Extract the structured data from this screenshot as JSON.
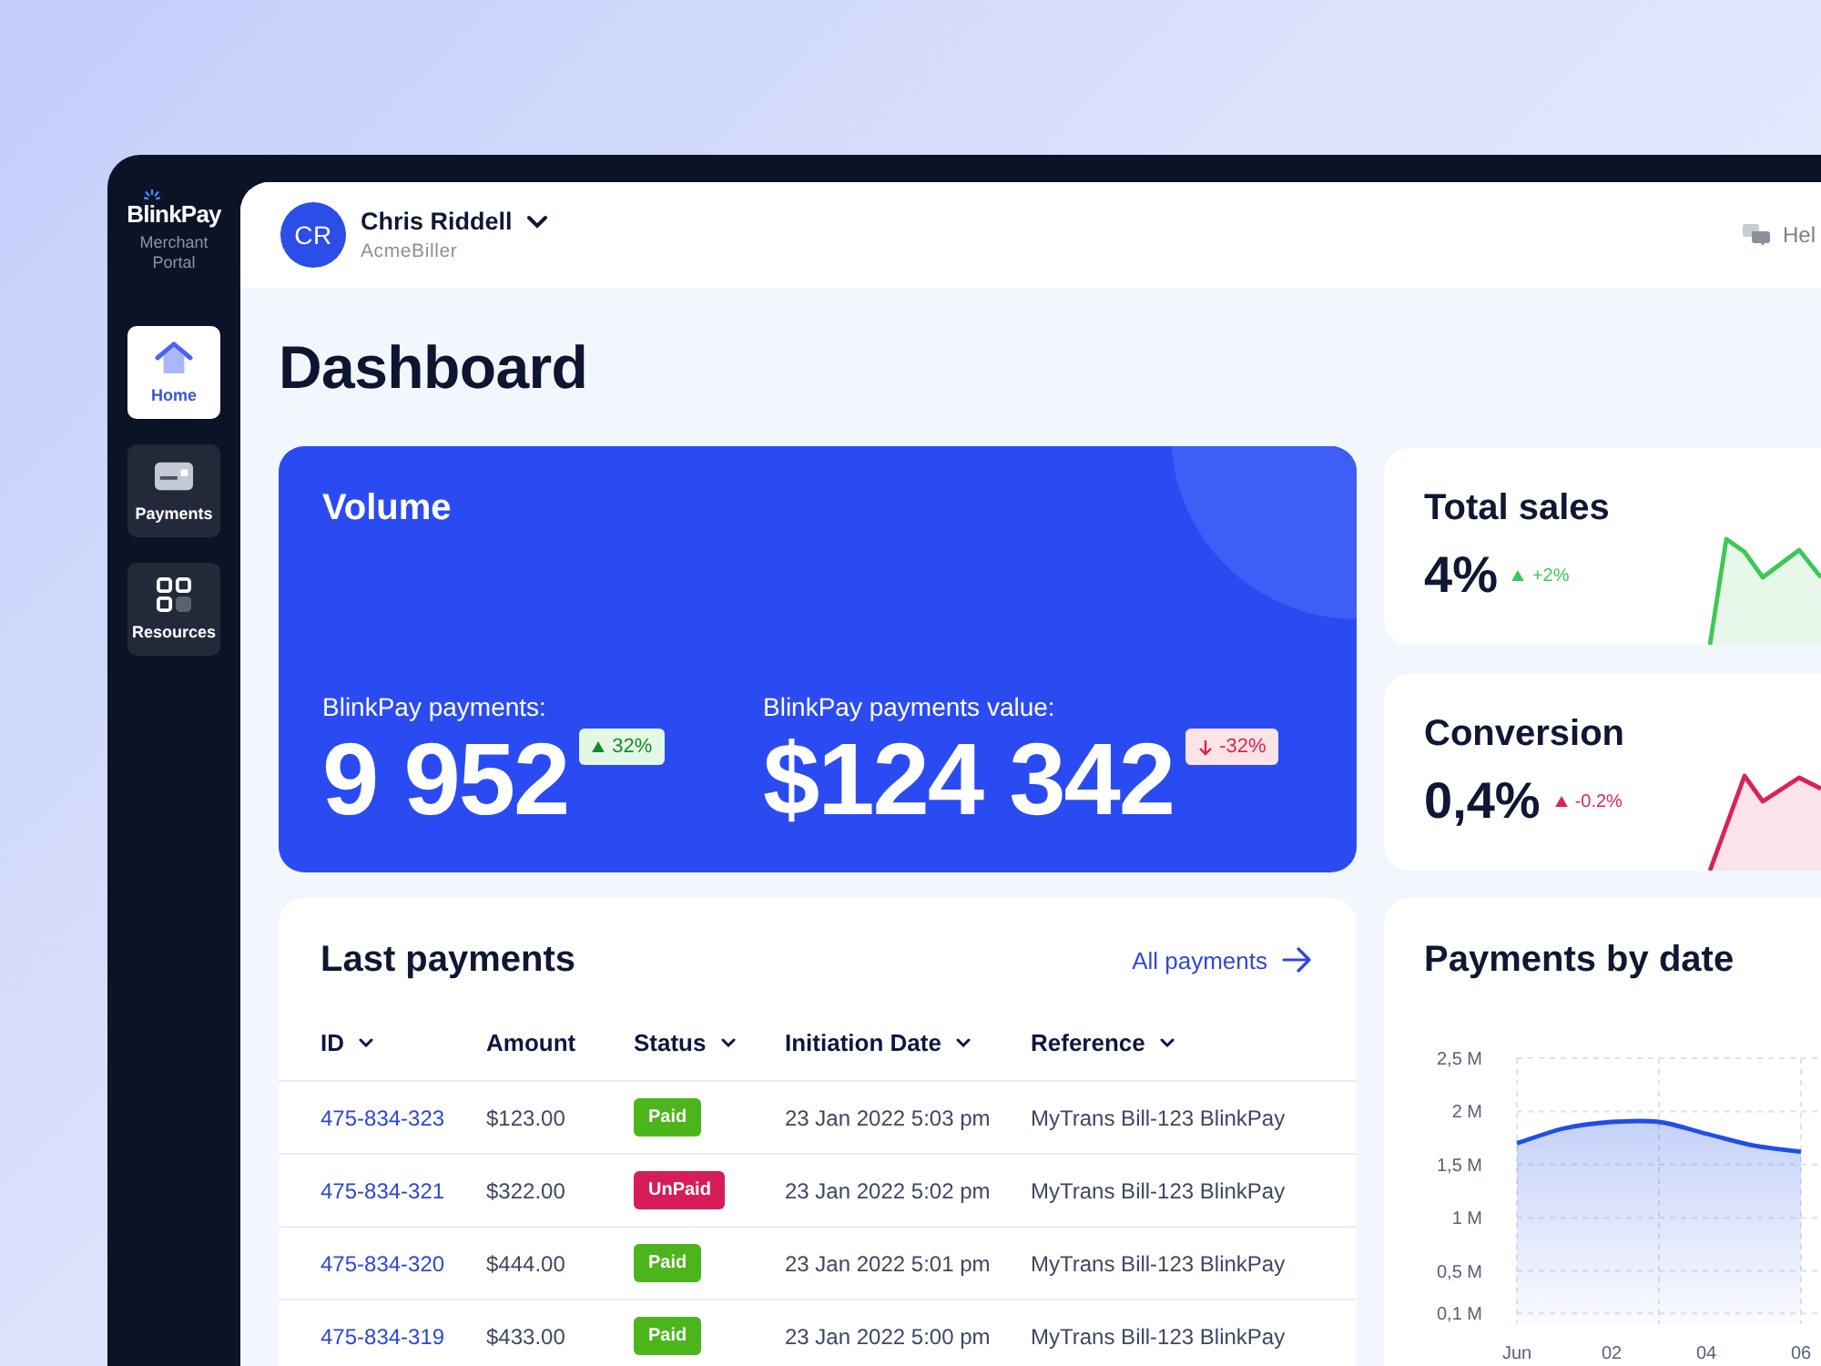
{
  "sidebar": {
    "logo": "BlinkPay",
    "subtitle": "Merchant Portal",
    "items": [
      {
        "label": "Home",
        "selected": true
      },
      {
        "label": "Payments",
        "selected": false
      },
      {
        "label": "Resources",
        "selected": false
      }
    ]
  },
  "header": {
    "user": {
      "initials": "CR",
      "name": "Chris Riddell",
      "company": "AcmeBiller"
    },
    "help": "Hel"
  },
  "page_title": "Dashboard",
  "volume": {
    "title": "Volume",
    "stats": [
      {
        "label": "BlinkPay payments:",
        "value": "9 952",
        "change": "32%",
        "kind": "up"
      },
      {
        "label": "BlinkPay payments value:",
        "value": "$124 342",
        "change": "-32%",
        "kind": "down"
      }
    ]
  },
  "metrics": [
    {
      "title": "Total sales",
      "value": "4%",
      "change": "+2%",
      "color": "#3cc853"
    },
    {
      "title": "Conversion",
      "value": "0,4%",
      "change": "-0.2%",
      "color": "#d92356"
    }
  ],
  "last_payments": {
    "title": "Last payments",
    "link": "All payments",
    "columns": [
      {
        "label": "ID",
        "sortable": true
      },
      {
        "label": "Amount",
        "sortable": false
      },
      {
        "label": "Status",
        "sortable": true
      },
      {
        "label": "Initiation Date",
        "sortable": true
      },
      {
        "label": "Reference",
        "sortable": true
      }
    ],
    "rows": [
      {
        "id": "475-834-323",
        "amount": "$123.00",
        "status": {
          "label": "Paid",
          "kind": "paid"
        },
        "date": "23 Jan 2022 5:03 pm",
        "reference": "MyTrans Bill-123 BlinkPay"
      },
      {
        "id": "475-834-321",
        "amount": "$322.00",
        "status": {
          "label": "UnPaid",
          "kind": "unpaid"
        },
        "date": "23 Jan 2022 5:02 pm",
        "reference": "MyTrans Bill-123 BlinkPay"
      },
      {
        "id": "475-834-320",
        "amount": "$444.00",
        "status": {
          "label": "Paid",
          "kind": "paid"
        },
        "date": "23 Jan 2022 5:01 pm",
        "reference": "MyTrans Bill-123 BlinkPay"
      },
      {
        "id": "475-834-319",
        "amount": "$433.00",
        "status": {
          "label": "Paid",
          "kind": "paid"
        },
        "date": "23 Jan 2022 5:00 pm",
        "reference": "MyTrans Bill-123 BlinkPay"
      }
    ]
  },
  "payments_by_date": {
    "chart_data": [
      {
        "type": "area",
        "title": "Payments by date",
        "categories": [
          "Jun",
          null,
          "02",
          null,
          "04",
          null,
          "06"
        ],
        "values": [
          1.7,
          1.84,
          1.9,
          1.9,
          1.79,
          1.68,
          1.62
        ],
        "yticks": [
          {
            "value": 0.1,
            "label": "0,1 M"
          },
          {
            "value": 0.5,
            "label": "0,5 M"
          },
          {
            "value": 1,
            "label": "1 M"
          },
          {
            "value": 1.5,
            "label": "1,5 M"
          },
          {
            "value": 2,
            "label": "2 M"
          },
          {
            "value": 2.5,
            "label": "2,5 M"
          }
        ],
        "ylim": [
          0,
          2.5
        ],
        "color": "#1f4ee8",
        "grid": true
      }
    ]
  }
}
